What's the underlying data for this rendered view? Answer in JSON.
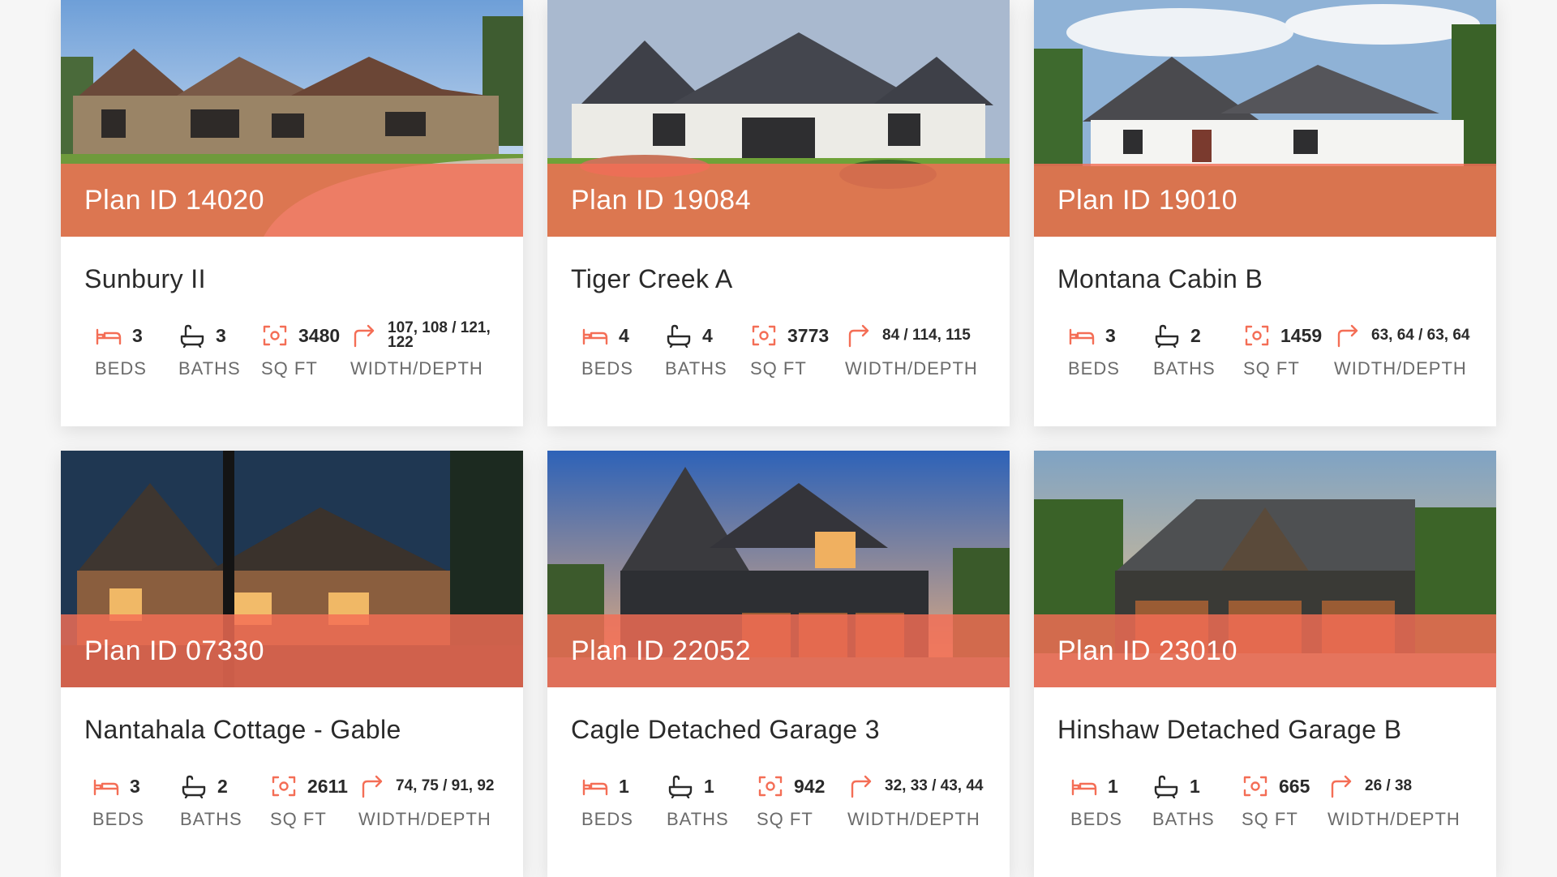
{
  "labels": {
    "beds": "BEDS",
    "baths": "BATHS",
    "sqft": "SQ FT",
    "width_depth": "WIDTH/DEPTH"
  },
  "colors": {
    "accent": "#f46e56",
    "title_text": "#2a2a2a",
    "label_text": "#6b6b6b",
    "card_bg": "#ffffff"
  },
  "icons": {
    "beds": "bed-icon",
    "baths": "bathtub-icon",
    "sqft": "area-icon",
    "width_depth": "dimensions-arrow-icon"
  },
  "cards": [
    {
      "plan_id": "Plan ID 14020",
      "name": "Sunbury II",
      "beds": "3",
      "baths": "3",
      "sqft": "3480",
      "width_depth": "107, 108 / 121, 122"
    },
    {
      "plan_id": "Plan ID 19084",
      "name": "Tiger Creek A",
      "beds": "4",
      "baths": "4",
      "sqft": "3773",
      "width_depth": "84 / 114, 115"
    },
    {
      "plan_id": "Plan ID 19010",
      "name": "Montana Cabin B",
      "beds": "3",
      "baths": "2",
      "sqft": "1459",
      "width_depth": "63, 64 / 63, 64"
    },
    {
      "plan_id": "Plan ID 07330",
      "name": "Nantahala Cottage - Gable",
      "beds": "3",
      "baths": "2",
      "sqft": "2611",
      "width_depth": "74, 75 / 91, 92"
    },
    {
      "plan_id": "Plan ID 22052",
      "name": "Cagle Detached Garage 3",
      "beds": "1",
      "baths": "1",
      "sqft": "942",
      "width_depth": "32, 33 / 43, 44"
    },
    {
      "plan_id": "Plan ID 23010",
      "name": "Hinshaw Detached Garage B",
      "beds": "1",
      "baths": "1",
      "sqft": "665",
      "width_depth": "26 / 38"
    }
  ]
}
